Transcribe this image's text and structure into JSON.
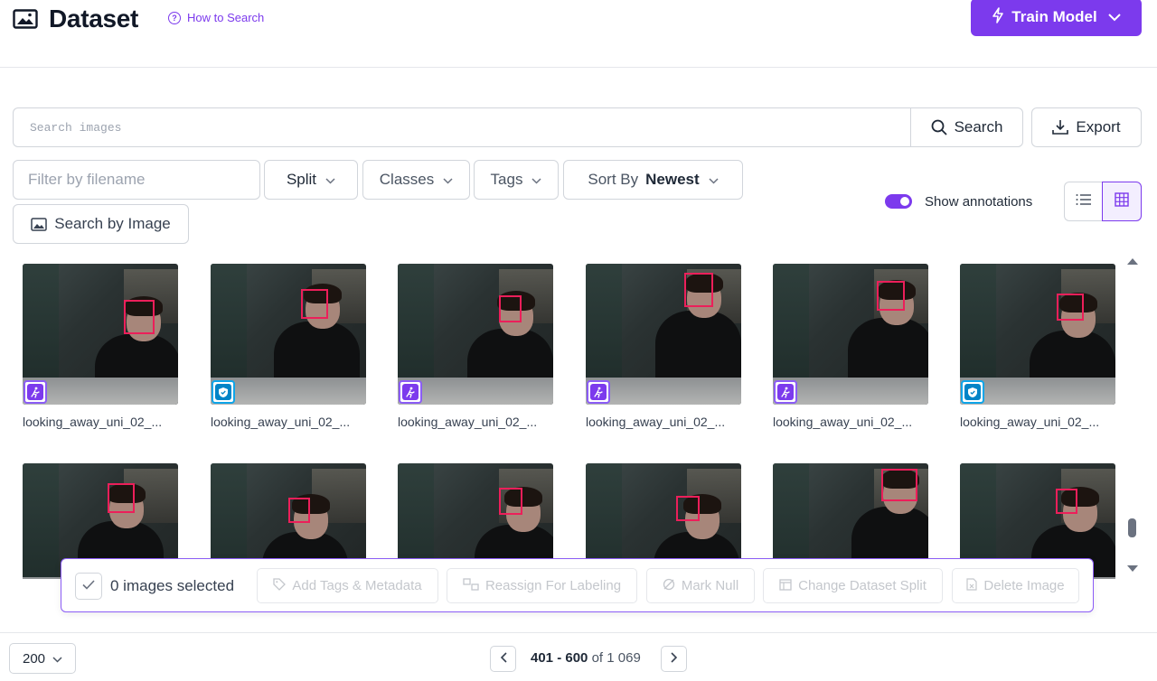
{
  "header": {
    "title": "Dataset",
    "title_icon": "image-icon",
    "how_to_search": "How to Search",
    "train_model": "Train Model"
  },
  "search": {
    "placeholder": "Search images",
    "button": "Search",
    "export": "Export"
  },
  "filters": {
    "filename_placeholder": "Filter by filename",
    "split": "Split",
    "classes": "Classes",
    "tags": "Tags",
    "sort_label": "Sort By",
    "sort_value": "Newest",
    "search_by_image": "Search by Image"
  },
  "view": {
    "show_annotations_label": "Show annotations",
    "show_annotations": true,
    "mode": "grid"
  },
  "grid": {
    "row1": [
      {
        "filename": "looking_away_uni_02_...",
        "badge": "purple",
        "badge_icon": "running-person-icon"
      },
      {
        "filename": "looking_away_uni_02_...",
        "badge": "blue",
        "badge_icon": "shield-check-icon"
      },
      {
        "filename": "looking_away_uni_02_...",
        "badge": "purple",
        "badge_icon": "running-person-icon"
      },
      {
        "filename": "looking_away_uni_02_...",
        "badge": "purple",
        "badge_icon": "running-person-icon"
      },
      {
        "filename": "looking_away_uni_02_...",
        "badge": "purple",
        "badge_icon": "running-person-icon"
      },
      {
        "filename": "looking_away_uni_02_...",
        "badge": "blue",
        "badge_icon": "shield-check-icon"
      }
    ]
  },
  "selection": {
    "count_text": "0 images selected",
    "actions": {
      "add_tags": "Add Tags & Metadata",
      "reassign": "Reassign For Labeling",
      "mark_null": "Mark Null",
      "change_split": "Change Dataset Split",
      "delete": "Delete Image"
    }
  },
  "pagination": {
    "per_page": "200",
    "range": "401 - 600",
    "of": "of",
    "total": "1 069"
  },
  "colors": {
    "accent": "#7c3aed",
    "bbox": "#ec1f5a",
    "badge_blue": "#0284c7"
  }
}
